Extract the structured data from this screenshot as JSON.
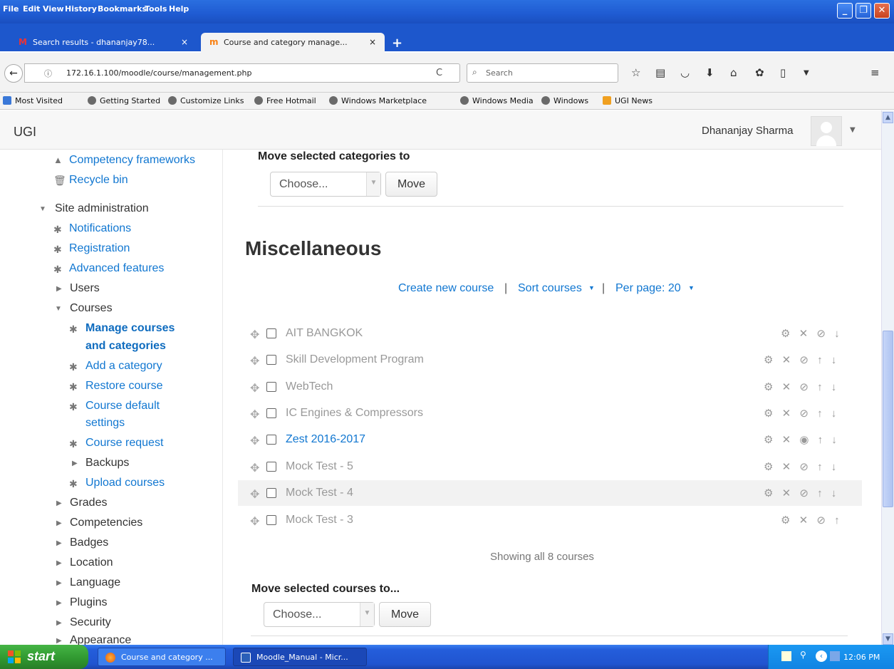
{
  "menubar": {
    "items": [
      "File",
      "Edit",
      "View",
      "History",
      "Bookmarks",
      "Tools",
      "Help"
    ]
  },
  "tabs": [
    {
      "label": "Search results - dhananjay78...",
      "close": "×"
    },
    {
      "label": "Course and category manage...",
      "close": "×"
    }
  ],
  "newtab": "+",
  "navbar": {
    "back": "←",
    "info": "ⓘ",
    "url": "172.16.1.100/moodle/course/management.php",
    "reload": "C",
    "search_placeholder": "Search"
  },
  "bookmarks": [
    "Most Visited",
    "Getting Started",
    "Customize Links",
    "Free Hotmail",
    "Windows Marketplace",
    "Windows Media",
    "Windows",
    "UGI News"
  ],
  "header": {
    "site_name": "UGI",
    "user_name": "Dhananjay Sharma"
  },
  "sidebar": {
    "competency_frameworks": "Competency frameworks",
    "recycle_bin": "Recycle bin",
    "site_administration": "Site administration",
    "notifications": "Notifications",
    "registration": "Registration",
    "advanced_features": "Advanced features",
    "users": "Users",
    "courses": "Courses",
    "manage_courses_1": "Manage courses",
    "manage_courses_2": "and categories",
    "add_category": "Add a category",
    "restore_course": "Restore course",
    "course_default_1": "Course default",
    "course_default_2": "settings",
    "course_request": "Course request",
    "backups": "Backups",
    "upload_courses": "Upload courses",
    "grades": "Grades",
    "competencies": "Competencies",
    "badges": "Badges",
    "location": "Location",
    "language": "Language",
    "plugins": "Plugins",
    "security": "Security",
    "appearance": "Appearance"
  },
  "main": {
    "move_categories_label": "Move selected categories to",
    "choose": "Choose...",
    "move": "Move",
    "category_title": "Miscellaneous",
    "create_new_course": "Create new course",
    "sort_courses": "Sort courses",
    "per_page": "Per page: 20",
    "courses": [
      {
        "name": "AIT BANGKOK",
        "visible": false,
        "actions": "⚙ ✕ ⊘ ↓"
      },
      {
        "name": "Skill Development Program",
        "visible": false,
        "actions": "⚙ ✕ ⊘ ↑ ↓"
      },
      {
        "name": "WebTech",
        "visible": false,
        "actions": "⚙ ✕ ⊘ ↑ ↓"
      },
      {
        "name": "IC Engines & Compressors",
        "visible": false,
        "actions": "⚙ ✕ ⊘ ↑ ↓"
      },
      {
        "name": "Zest 2016-2017",
        "visible": true,
        "actions": "⚙ ✕ ◉ ↑ ↓"
      },
      {
        "name": "Mock Test - 5",
        "visible": false,
        "actions": "⚙ ✕ ⊘ ↑ ↓"
      },
      {
        "name": "Mock Test - 4",
        "visible": false,
        "actions": "⚙ ✕ ⊘ ↑ ↓"
      },
      {
        "name": "Mock Test - 3",
        "visible": false,
        "actions": "⚙ ✕ ⊘ ↑"
      }
    ],
    "showing": "Showing all 8 courses",
    "move_courses_label": "Move selected courses to..."
  },
  "taskbar": {
    "start": "start",
    "task1": "Course and category ...",
    "task2": "Moodle_Manual - Micr...",
    "clock": "12:06 PM"
  },
  "colors": {
    "link": "#1177d1",
    "xp_blue": "#245edb",
    "start_green": "#2f962f"
  }
}
